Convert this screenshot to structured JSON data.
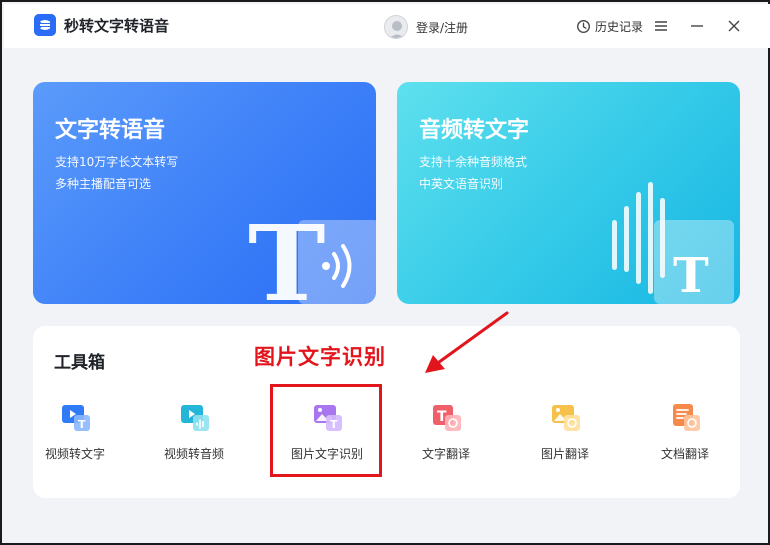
{
  "app": {
    "title": "秒转文字转语音",
    "brand_color": "#2b6cf6"
  },
  "header": {
    "login_label": "登录/注册",
    "history_label": "历史记录"
  },
  "cards": [
    {
      "title": "文字转语音",
      "desc1": "支持10万字长文本转写",
      "desc2": "多种主播配音可选",
      "color": "#3d80f8"
    },
    {
      "title": "音频转文字",
      "desc1": "支持十余种音频格式",
      "desc2": "中英文语音识别",
      "color": "#33c9e8"
    }
  ],
  "toolbox": {
    "title": "工具箱",
    "tools": [
      {
        "label": "视频转文字",
        "icon": "video-to-text-icon"
      },
      {
        "label": "视频转音频",
        "icon": "video-to-audio-icon"
      },
      {
        "label": "图片文字识别",
        "icon": "image-ocr-icon"
      },
      {
        "label": "文字翻译",
        "icon": "text-translate-icon"
      },
      {
        "label": "图片翻译",
        "icon": "image-translate-icon"
      },
      {
        "label": "文档翻译",
        "icon": "document-translate-icon"
      }
    ]
  },
  "annotation": {
    "text": "图片文字识别",
    "color": "#e3151c"
  }
}
